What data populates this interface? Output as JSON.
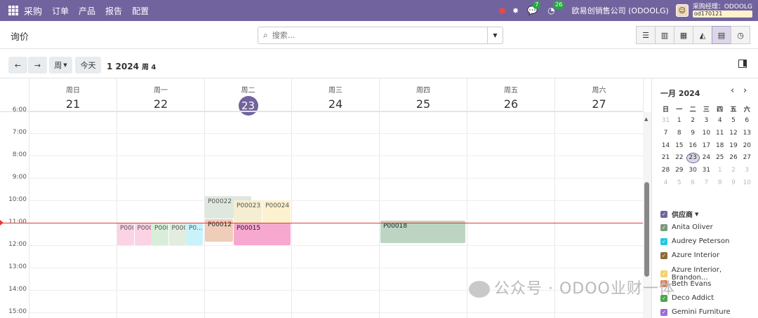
{
  "navbar": {
    "app_name": "采购",
    "menu": [
      "订单",
      "产品",
      "报告",
      "配置"
    ],
    "chat_count": "7",
    "activity_count": "26",
    "company": "欧易创销售公司 (ODOOLG)",
    "user_role": "采购经理：ODOOLG",
    "db_name": "od170121"
  },
  "control_panel": {
    "breadcrumb": "询价",
    "search_placeholder": "搜索..."
  },
  "toolbar": {
    "prev": "←",
    "next": "→",
    "scale": "周",
    "today": "今天",
    "range": "1 2024",
    "week": "周 4"
  },
  "calendar": {
    "days": [
      {
        "name": "周日",
        "date": "21"
      },
      {
        "name": "周一",
        "date": "22"
      },
      {
        "name": "周二",
        "date": "23",
        "today": true
      },
      {
        "name": "周三",
        "date": "24"
      },
      {
        "name": "周四",
        "date": "25"
      },
      {
        "name": "周五",
        "date": "26"
      },
      {
        "name": "周六",
        "date": "27"
      }
    ],
    "hours": [
      "6:00",
      "7:00",
      "8:00",
      "9:00",
      "10:00",
      "11:00",
      "12:00",
      "13:00",
      "14:00",
      "15:00"
    ],
    "events": [
      {
        "label": "P000",
        "day": 1,
        "col": 0,
        "start": 11.0,
        "end": 12.0,
        "color": "#fbd3e4"
      },
      {
        "label": "P000",
        "day": 1,
        "col": 1,
        "start": 11.0,
        "end": 12.0,
        "color": "#fbd3e4"
      },
      {
        "label": "P000",
        "day": 1,
        "col": 2,
        "start": 11.0,
        "end": 12.0,
        "color": "#d8eed8"
      },
      {
        "label": "P000",
        "day": 1,
        "col": 3,
        "start": 11.0,
        "end": 12.0,
        "color": "#e3ecdf"
      },
      {
        "label": "P0...",
        "day": 1,
        "col": 4,
        "start": 11.0,
        "end": 12.0,
        "color": "#c9f2fa"
      },
      {
        "label": "P00022",
        "day": 2,
        "start": 9.8,
        "end": 10.8,
        "color": "#dfe8df"
      },
      {
        "label": "P00023",
        "day": 2,
        "start": 10.0,
        "end": 11.0,
        "color": "#f5eed2"
      },
      {
        "label": "P00024",
        "day": 2,
        "start": 10.0,
        "end": 11.0,
        "color": "#fdf2cf"
      },
      {
        "label": "P00012",
        "day": 2,
        "start": 10.85,
        "end": 11.85,
        "color": "#f0cdb8"
      },
      {
        "label": "P00015",
        "day": 2,
        "start": 11.0,
        "end": 12.0,
        "color": "#f6a8cf"
      },
      {
        "label": "P00018",
        "day": 4,
        "start": 10.9,
        "end": 11.9,
        "color": "#bdd4c2"
      }
    ]
  },
  "mini_calendar": {
    "title": "一月 2024",
    "weekdays": [
      "日",
      "一",
      "二",
      "三",
      "四",
      "五",
      "六"
    ],
    "weeks": [
      [
        "31",
        "1",
        "2",
        "3",
        "4",
        "5",
        "6"
      ],
      [
        "7",
        "8",
        "9",
        "10",
        "11",
        "12",
        "13"
      ],
      [
        "14",
        "15",
        "16",
        "17",
        "18",
        "19",
        "20"
      ],
      [
        "21",
        "22",
        "23",
        "24",
        "25",
        "26",
        "27"
      ],
      [
        "28",
        "29",
        "30",
        "31",
        "1",
        "2",
        "3"
      ],
      [
        "4",
        "5",
        "6",
        "7",
        "8",
        "9",
        "10"
      ]
    ],
    "today": "23"
  },
  "filters": {
    "header": "供应商",
    "items": [
      {
        "name": "Anita Oliver",
        "color": "#7a9a7e"
      },
      {
        "name": "Audrey Peterson",
        "color": "#1fc8e0"
      },
      {
        "name": "Azure Interior",
        "color": "#8b6a38"
      },
      {
        "name": "Azure Interior, Brandon...",
        "color": "#f3d46a"
      },
      {
        "name": "Beth Evans",
        "color": "#e07b54"
      },
      {
        "name": "Deco Addict",
        "color": "#4ca64c"
      },
      {
        "name": "Gemini Furniture",
        "color": "#9b6ed6"
      }
    ]
  },
  "watermark": "公众号 · ODOO业财一体"
}
